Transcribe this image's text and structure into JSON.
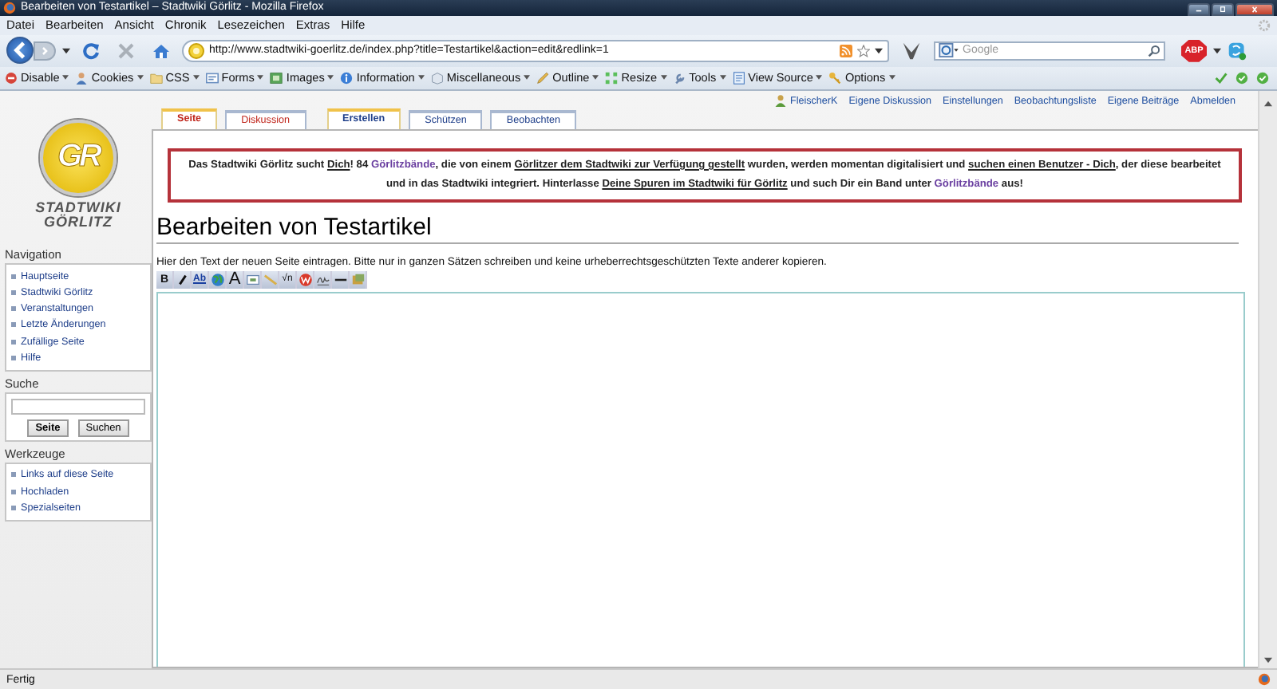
{
  "window": {
    "title": "Bearbeiten von Testartikel – Stadtwiki Görlitz - Mozilla Firefox"
  },
  "menu": [
    "Datei",
    "Bearbeiten",
    "Ansicht",
    "Chronik",
    "Lesezeichen",
    "Extras",
    "Hilfe"
  ],
  "address_bar": {
    "url": "http://www.stadtwiki-goerlitz.de/index.php?title=Testartikel&action=edit&redlink=1"
  },
  "search_bar": {
    "placeholder": "Google"
  },
  "addon_badge": "ABP",
  "dev_toolbar": [
    {
      "kind": "disable",
      "label": "Disable"
    },
    {
      "kind": "cookies",
      "label": "Cookies"
    },
    {
      "kind": "css",
      "label": "CSS"
    },
    {
      "kind": "forms",
      "label": "Forms"
    },
    {
      "kind": "images",
      "label": "Images"
    },
    {
      "kind": "information",
      "label": "Information"
    },
    {
      "kind": "misc",
      "label": "Miscellaneous"
    },
    {
      "kind": "outline",
      "label": "Outline"
    },
    {
      "kind": "resize",
      "label": "Resize"
    },
    {
      "kind": "tools",
      "label": "Tools"
    },
    {
      "kind": "source",
      "label": "View Source"
    },
    {
      "kind": "options",
      "label": "Options"
    }
  ],
  "logo": {
    "mark": "GR",
    "line_1": "STADTWIKI",
    "line_2": "GÖRLITZ"
  },
  "sidebar": [
    {
      "title": "Navigation",
      "kind": "links",
      "items": [
        "Hauptseite",
        "Stadtwiki Görlitz",
        "Veranstaltungen",
        "Letzte Änderungen",
        "Zufällige Seite",
        "Hilfe"
      ]
    },
    {
      "title": "Suche",
      "kind": "search",
      "buttons": [
        "Seite",
        "Suchen"
      ]
    },
    {
      "title": "Werkzeuge",
      "kind": "links",
      "items": [
        "Links auf diese Seite",
        "Hochladen",
        "Spezialseiten"
      ]
    }
  ],
  "personal_tools": [
    {
      "label": "FleischerK",
      "kind": "user"
    },
    {
      "label": "Eigene Diskussion",
      "kind": "link"
    },
    {
      "label": "Einstellungen",
      "kind": "link"
    },
    {
      "label": "Beobachtungsliste",
      "kind": "link"
    },
    {
      "label": "Eigene Beiträge",
      "kind": "link"
    },
    {
      "label": "Abmelden",
      "kind": "link"
    }
  ],
  "tabs": [
    {
      "label": "Seite",
      "selected": true,
      "missing": true
    },
    {
      "label": "Diskussion",
      "selected": false,
      "missing": true
    },
    {
      "label": "Erstellen",
      "selected": true,
      "missing": false
    },
    {
      "label": "Schützen",
      "selected": false,
      "missing": false
    },
    {
      "label": "Beobachten",
      "selected": false,
      "missing": false
    }
  ],
  "notice": [
    {
      "kind": "plain",
      "text": "Das Stadtwiki Görlitz sucht "
    },
    {
      "kind": "link",
      "text": "Dich"
    },
    {
      "kind": "plain",
      "text": "! 84 "
    },
    {
      "kind": "visited",
      "text": "Görlitzbände"
    },
    {
      "kind": "plain",
      "text": ", die von einem "
    },
    {
      "kind": "link",
      "text": "Görlitzer dem Stadtwiki zur Verfügung gestellt"
    },
    {
      "kind": "plain",
      "text": " wurden, werden momentan digitalisiert und "
    },
    {
      "kind": "link",
      "text": "suchen einen Benutzer - Dich"
    },
    {
      "kind": "plain",
      "text": ", der diese bearbeitet und in das Stadtwiki integriert. Hinterlasse "
    },
    {
      "kind": "link",
      "text": "Deine Spuren im Stadtwiki für Görlitz"
    },
    {
      "kind": "plain",
      "text": " und such Dir ein Band unter "
    },
    {
      "kind": "visited",
      "text": "Görlitzbände"
    },
    {
      "kind": "plain",
      "text": " aus!"
    }
  ],
  "heading": "Bearbeiten von Testartikel",
  "instructions": "Hier den Text der neuen Seite eintragen. Bitte nur in ganzen Sätzen schreiben und keine urheberrechtsgeschützten Texte anderer kopieren.",
  "edit_toolbar": [
    {
      "kind": "bold",
      "label": "B"
    },
    {
      "kind": "italic"
    },
    {
      "kind": "link",
      "label": "Ab"
    },
    {
      "kind": "globe"
    },
    {
      "kind": "headline",
      "label": "A"
    },
    {
      "kind": "image"
    },
    {
      "kind": "media"
    },
    {
      "kind": "math",
      "label": "√n"
    },
    {
      "kind": "nowiki"
    },
    {
      "kind": "signature"
    },
    {
      "kind": "rule"
    },
    {
      "kind": "gallery"
    }
  ],
  "status_bar": {
    "text": "Fertig"
  }
}
